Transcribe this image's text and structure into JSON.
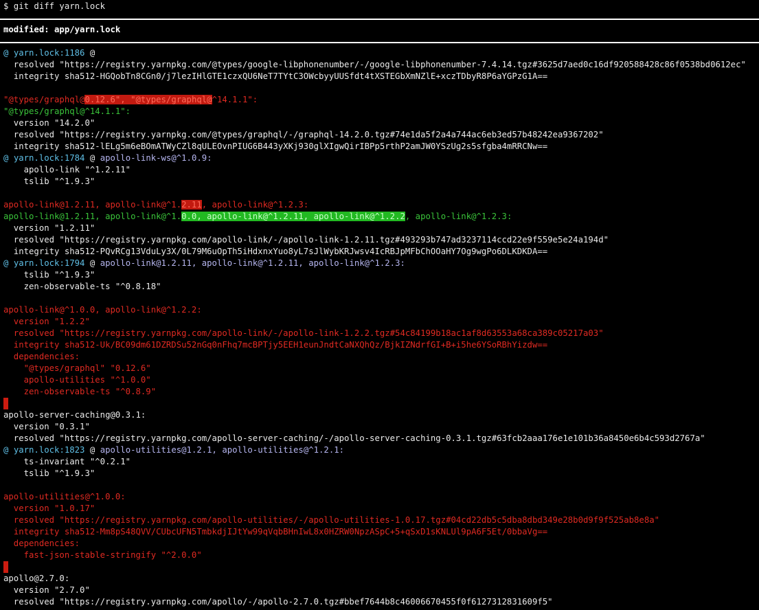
{
  "prompt": "$ git diff yarn.lock",
  "file_header": "modified: app/yarn.lock",
  "hunk1": {
    "prefix": "@ ",
    "loc": "yarn.lock:1186",
    "suffix": " @"
  },
  "l1_resolved": "  resolved \"https://registry.yarnpkg.com/@types/google-libphonenumber/-/google-libphonenumber-7.4.14.tgz#3625d7aed0c16df920588428c86f0538bd0612ec\"",
  "l1_integrity": "  integrity sha512-HGQobTn8CGn0/j7lezIHlGTE1czxQU6NeT7TYtC3OWcbyyUUSfdt4tXSTEGbXmNZlE+xczTDbyR8P6aYGPzG1A==",
  "gq_old": {
    "a": "\"@types/graphql@",
    "b": "0.12.6",
    "c": "\", \"@types/graphql@",
    "d": "^14.1.1\":"
  },
  "gq_new": "\"@types/graphql@^14.1.1\":",
  "gq_version": "  version \"14.2.0\"",
  "gq_resolved": "  resolved \"https://registry.yarnpkg.com/@types/graphql/-/graphql-14.2.0.tgz#74e1da5f2a4a744ac6eb3ed57b48242ea9367202\"",
  "gq_integrity": "  integrity sha512-lELg5m6eBOmATWyCZl8qULEOvnPIUG6B443yXKj930glXIgwQirIBPp5rthP2amJW0YSzUg2s5sfgba4mRRCNw==",
  "hunk2": {
    "prefix": "@ ",
    "loc": "yarn.lock:1784",
    "mid": " @ ",
    "ctx": "apollo-link-ws@^1.0.9:"
  },
  "h2_l1": "    apollo-link \"^1.2.11\"",
  "h2_l2": "    tslib \"^1.9.3\"",
  "al_old": {
    "a": "apollo-link@1.2.11, apollo-link@^1.",
    "b": "2.11",
    "c": ", apollo-link@^1.2.3:"
  },
  "al_new": {
    "a": "apollo-link@1.2.11, apollo-link@^1.",
    "b": "0.0, apollo-link@^1.2.11, apollo-link@^1.2.2",
    "c": ", apollo-link@^1.2.3:"
  },
  "al_version": "  version \"1.2.11\"",
  "al_resolved": "  resolved \"https://registry.yarnpkg.com/apollo-link/-/apollo-link-1.2.11.tgz#493293b747ad3237114ccd22e9f559e5e24a194d\"",
  "al_integrity": "  integrity sha512-PQvRCg13VduLy3X/0L79M6uOpTh5iHdxnxYuo8yL7sJlWybKRJwsv4IcRBJpMFbChOOaHY7Og9wgPo6DLKDKDA==",
  "hunk3": {
    "prefix": "@ ",
    "loc": "yarn.lock:1794",
    "mid": " @ ",
    "ctx": "apollo-link@1.2.11, apollo-link@^1.2.11, apollo-link@^1.2.3:"
  },
  "h3_l1": "    tslib \"^1.9.3\"",
  "h3_l2": "    zen-observable-ts \"^0.8.18\"",
  "rm1": [
    "apollo-link@^1.0.0, apollo-link@^1.2.2:",
    "  version \"1.2.2\"",
    "  resolved \"https://registry.yarnpkg.com/apollo-link/-/apollo-link-1.2.2.tgz#54c84199b18ac1af8d63553a68ca389c05217a03\"",
    "  integrity sha512-Uk/BC09dm61DZRDSu52nGq0nFhq7mcBPTjy5EEH1eunJndtCaNXQhQz/BjkIZNdrfGI+B+i5he6YSoRBhYizdw==",
    "  dependencies:",
    "    \"@types/graphql\" \"0.12.6\"",
    "    apollo-utilities \"^1.0.0\"",
    "    zen-observable-ts \"^0.8.9\""
  ],
  "asc": [
    "apollo-server-caching@0.3.1:",
    "  version \"0.3.1\"",
    "  resolved \"https://registry.yarnpkg.com/apollo-server-caching/-/apollo-server-caching-0.3.1.tgz#63fcb2aaa176e1e101b36a8450e6b4c593d2767a\""
  ],
  "hunk4": {
    "prefix": "@ ",
    "loc": "yarn.lock:1823",
    "mid": " @ ",
    "ctx": "apollo-utilities@1.2.1, apollo-utilities@^1.2.1:"
  },
  "h4_l1": "    ts-invariant \"^0.2.1\"",
  "h4_l2": "    tslib \"^1.9.3\"",
  "rm2": [
    "apollo-utilities@^1.0.0:",
    "  version \"1.0.17\"",
    "  resolved \"https://registry.yarnpkg.com/apollo-utilities/-/apollo-utilities-1.0.17.tgz#04cd22db5c5dba8dbd349e28b0d9f9f525ab8e8a\"",
    "  integrity sha512-Mm8pS48QVV/CUbcUFN5TmbkdjIJtYw99qVqbBHnIwL8x0HZRW0NpzASpC+5+qSxD1sKNLUl9pA6F5Et/0bbaVg==",
    "  dependencies:",
    "    fast-json-stable-stringify \"^2.0.0\""
  ],
  "ap": [
    "apollo@2.7.0:",
    "  version \"2.7.0\"",
    "  resolved \"https://registry.yarnpkg.com/apollo/-/apollo-2.7.0.tgz#bbef7644b8c46006670455f0f6127312831609f5\""
  ]
}
